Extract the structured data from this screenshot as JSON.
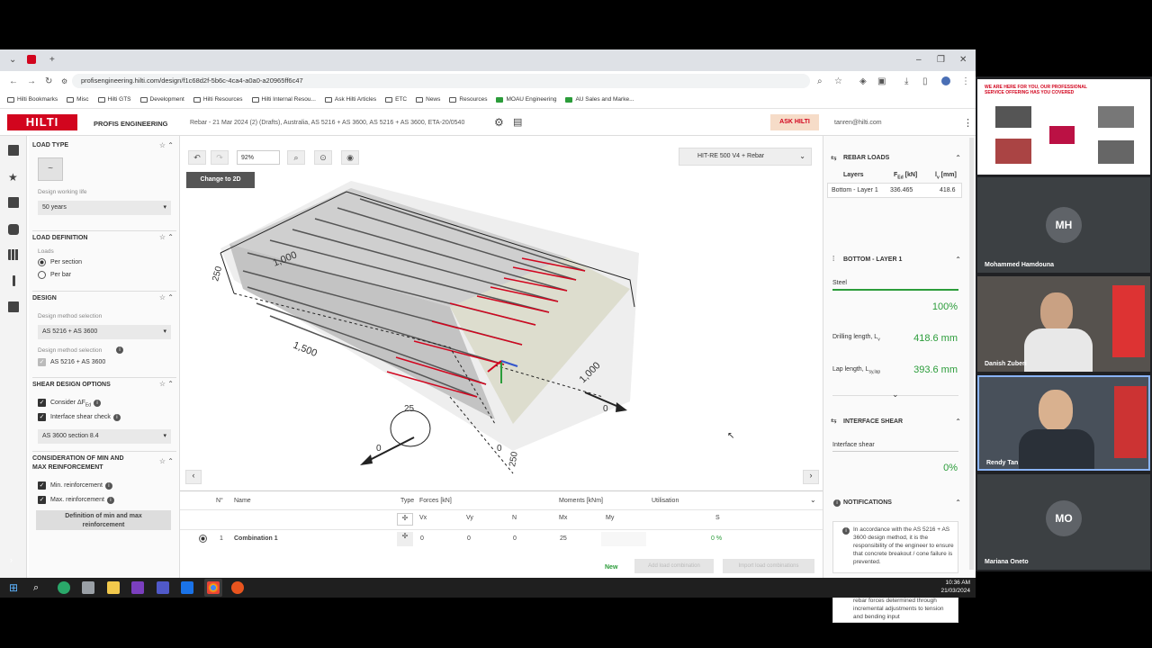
{
  "browser": {
    "url": "profisengineering.hilti.com/design/f1c68d2f-5b6c-4ca4-a0a0-a20965ff6c47",
    "bookmarks": [
      "Hilti Bookmarks",
      "Misc",
      "Hilti GTS",
      "Development",
      "Hilti Resources",
      "Hilti Internal Resou...",
      "Ask Hilti Articles",
      "ETC",
      "News",
      "Resources",
      "MOAU Engineering",
      "AU Sales and Marke..."
    ]
  },
  "app": {
    "logo": "HILTI",
    "product": "PROFIS ENGINEERING",
    "breadcrumb": "Rebar - 21 Mar 2024 (2) (Drafts), Australia, AS 5216 + AS 3600, AS 5216 + AS 3600, ETA-20/0540",
    "ask_hilti": "ASK HILTI",
    "user": "tanren@hilti.com"
  },
  "left": {
    "load_type": {
      "title": "LOAD TYPE",
      "working_life_label": "Design working life",
      "working_life": "50 years"
    },
    "load_definition": {
      "title": "LOAD DEFINITION",
      "loads_label": "Loads",
      "per_section": "Per section",
      "per_bar": "Per bar"
    },
    "design": {
      "title": "DESIGN",
      "method_label": "Design method selection",
      "method": "AS 5216 + AS 3600",
      "method_label2": "Design method selection",
      "method2": "AS 5216 + AS 3600"
    },
    "shear": {
      "title": "SHEAR DESIGN OPTIONS",
      "consider": "Consider ΔF",
      "consider_sub": "Ed",
      "interface_check": "Interface shear check",
      "section": "AS 3600 section 8.4"
    },
    "minmax": {
      "title1": "CONSIDERATION OF MIN AND",
      "title2": "MAX REINFORCEMENT",
      "min": "Min. reinforcement",
      "max": "Max. reinforcement",
      "definition1": "Definition of min and max",
      "definition2": "reinforcement"
    }
  },
  "viewport": {
    "zoom": "92%",
    "change_2d": "Change to 2D",
    "product": "HIT-RE 500 V4 + Rebar",
    "dims": {
      "d1": "1,000",
      "d2": "250",
      "d3": "1,500",
      "d4": "1,000",
      "d5": "250",
      "m25": "25",
      "z1": "0",
      "z2": "0",
      "z3": "0"
    },
    "axes": {
      "x": "x",
      "y": "Y",
      "z": "z"
    }
  },
  "table": {
    "headers": {
      "no": "N°",
      "name": "Name",
      "type": "Type",
      "forces": "Forces [kN]",
      "moments": "Moments [kNm]",
      "util": "Utilisation"
    },
    "sub": {
      "vx": "Vx",
      "vy": "Vy",
      "n": "N",
      "mx": "Mx",
      "my": "My",
      "s": "S"
    },
    "row": {
      "no": "1",
      "name": "Combination 1",
      "vx": "0",
      "vy": "0",
      "n": "0",
      "mx": "25",
      "my": "",
      "s": "0 %"
    },
    "new": "New",
    "add_load": "Add load combination",
    "import": "Import load combinations"
  },
  "right": {
    "rebar_loads": "REBAR LOADS",
    "col_layers": "Layers",
    "col_fed": "F",
    "col_fed_sub": "Ed",
    "col_fed_unit": " [kN]",
    "col_lv": "l",
    "col_lv_sub": "v",
    "col_lv_unit": " [mm]",
    "row_layer": "Bottom - Layer 1",
    "row_fed": "336.465",
    "row_lv": "418.6",
    "bottom_layer": "BOTTOM - LAYER 1",
    "steel": "Steel",
    "steel_pct": "100%",
    "drilling_label": "Drilling length, L",
    "drilling_sub": "v",
    "drilling_val": "418.6 mm",
    "lap_label": "Lap length, L",
    "lap_sub": "sy,lap",
    "lap_val": "393.6 mm",
    "interface_shear": "INTERFACE SHEAR",
    "interface_label": "Interface shear",
    "interface_pct": "0%",
    "notifications": "NOTIFICATIONS",
    "note1": "In accordance with the AS 5216 + AS 3600 design method, it is the responsibility of the engineer to ensure that concrete breakout / cone failure is prevented.",
    "note2": "Design for yield is considered, with rebar forces determined through incremental adjustments to tension and bending input"
  },
  "taskbar": {
    "time": "10:36 AM",
    "date": "21/03/2024"
  },
  "video": {
    "slide_title": "WE ARE HERE FOR YOU, OUR PROFESSIONAL SERVICE OFFERING HAS YOU COVERED",
    "participants": [
      {
        "initials": "MH",
        "name": "Mohammed Hamdouna"
      },
      {
        "initials": "",
        "name": "Danish Zuberi"
      },
      {
        "initials": "",
        "name": "Rendy Tan"
      },
      {
        "initials": "MO",
        "name": "Mariana Oneto"
      }
    ]
  },
  "colors": {
    "brand": "#d2051e",
    "green": "#2b9c3a"
  }
}
